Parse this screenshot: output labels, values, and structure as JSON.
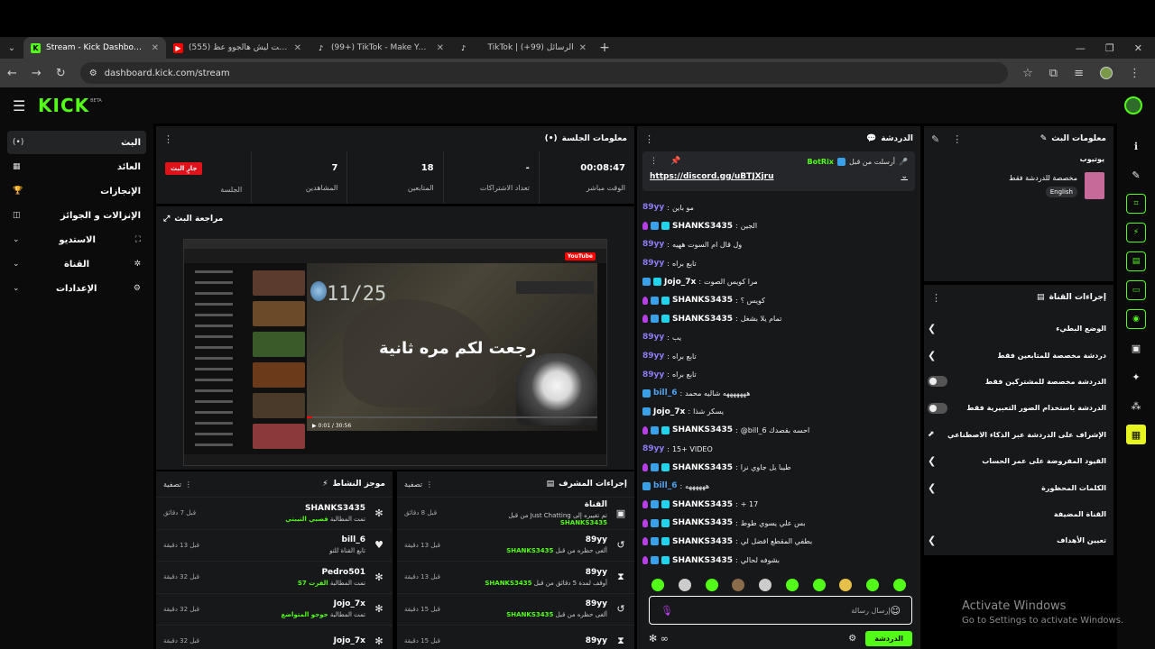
{
  "browser": {
    "tabs": [
      {
        "label": "Stream - Kick Dashboard",
        "active": true,
        "icon": "kick-icon"
      },
      {
        "label": "(555) عرفت ليش هالجوو عظ...",
        "active": false,
        "icon": "youtube-icon"
      },
      {
        "label": "(99+) TikTok - Make Your Day",
        "active": false,
        "icon": "tiktok-icon"
      },
      {
        "label": "TikTok | الرسائل (99+)",
        "active": false,
        "icon": "tiktok-icon"
      }
    ],
    "url": "dashboard.kick.com/stream"
  },
  "header": {
    "logo": "KICK",
    "beta": "BETA"
  },
  "sidebar": {
    "items": [
      {
        "label": "البث",
        "icon": "(•)"
      },
      {
        "label": "العائد",
        "icon": "▦"
      },
      {
        "label": "الإنجازات",
        "icon": "🏆"
      },
      {
        "label": "الإنزالات و الجوائز",
        "icon": "◫"
      },
      {
        "label": "الاستديو",
        "icon": "⛶"
      },
      {
        "label": "القناة",
        "icon": "✲"
      },
      {
        "label": "الإعدادات",
        "icon": "⚙"
      }
    ]
  },
  "session": {
    "title": "معلومات الجلسة",
    "live_badge": "جارٍ البث",
    "stats": [
      {
        "value": "00:08:47",
        "label": "الوقت مباشر"
      },
      {
        "value": "-",
        "label": "تعداد الاشتراكات"
      },
      {
        "value": "18",
        "label": "المتابعين"
      },
      {
        "value": "7",
        "label": "المشاهدين"
      },
      {
        "value": "",
        "label": "الجلسة"
      }
    ]
  },
  "preview": {
    "title": "مراجعة البث",
    "counter": "11/25",
    "caption": "رجعت لكم مره ثانية",
    "time": "0:01 / 30:56",
    "progress": 0.02
  },
  "activity": {
    "title": "موجز النشاط",
    "filter": "تصفية",
    "rows": [
      {
        "user": "SHANKS3435",
        "text": "تمت المطالبة",
        "highlight": "قصبي التيبتي",
        "time": "قبل 7 دقائق",
        "icon": "✻"
      },
      {
        "user": "bill_6",
        "text": "تابع القناة للتو",
        "highlight": "",
        "time": "قبل 13 دقيقة",
        "icon": "♥"
      },
      {
        "user": "Pedro501",
        "text": "تمت المطالبة",
        "highlight": "الفرت S7",
        "time": "قبل 32 دقيقة",
        "icon": "✻"
      },
      {
        "user": "Jojo_7x",
        "text": "تمت المطالبة",
        "highlight": "جوجو المتواضع",
        "time": "قبل 32 دقيقة",
        "icon": "✻"
      },
      {
        "user": "Jojo_7x",
        "text": "",
        "highlight": "",
        "time": "قبل 32 دقيقة",
        "icon": "✻"
      }
    ]
  },
  "mod_actions": {
    "title": "إجراءات المشرف",
    "filter": "تصفية",
    "rows": [
      {
        "user": "القناة",
        "text": "تم تغييره إلى Just Chatting من قبل",
        "highlight": "SHANKS3435",
        "time": "قبل 8 دقائق",
        "icon": "▣"
      },
      {
        "user": "89yy",
        "text": "ألغى حظره من قبل",
        "highlight": "SHANKS3435",
        "time": "قبل 13 دقيقة",
        "icon": "↺"
      },
      {
        "user": "89yy",
        "text": "أوقف لمدة 5 دقائق من قبل",
        "highlight": "SHANKS3435",
        "time": "قبل 13 دقيقة",
        "icon": "⧗"
      },
      {
        "user": "89yy",
        "text": "ألغى حظره من قبل",
        "highlight": "SHANKS3435",
        "time": "قبل 15 دقيقة",
        "icon": "↺"
      },
      {
        "user": "89yy",
        "text": "",
        "highlight": "",
        "time": "قبل 15 دقيقة",
        "icon": "⧗"
      }
    ]
  },
  "chat": {
    "title": "الدردشة",
    "pinned": {
      "from_label": "أرسلت من قبل",
      "user": "BotRix",
      "link": "https://discord.gg/uBTJXjru"
    },
    "messages": [
      {
        "user": "89yy",
        "color": "#8b7cf6",
        "text": "مو باين",
        "badges": []
      },
      {
        "user": "SHANKS3435",
        "color": "#ffffff",
        "text": "الجين",
        "badges": [
          "mic",
          "mod",
          "cyan"
        ]
      },
      {
        "user": "89yy",
        "color": "#8b7cf6",
        "text": "ول قال ام السوت ههيه",
        "badges": []
      },
      {
        "user": "89yy",
        "color": "#8b7cf6",
        "text": "تابع براه",
        "badges": []
      },
      {
        "user": "Jojo_7x",
        "color": "#ffffff",
        "text": "مرا كويس الصوت",
        "badges": [
          "mod",
          "cyan"
        ]
      },
      {
        "user": "SHANKS3435",
        "color": "#ffffff",
        "text": "كويس ؟",
        "badges": [
          "mic",
          "mod",
          "cyan"
        ]
      },
      {
        "user": "SHANKS3435",
        "color": "#ffffff",
        "text": "تمام يلا بشغل",
        "badges": [
          "mic",
          "mod",
          "cyan"
        ]
      },
      {
        "user": "89yy",
        "color": "#8b7cf6",
        "text": "يب",
        "badges": []
      },
      {
        "user": "89yy",
        "color": "#8b7cf6",
        "text": "تابع براه",
        "badges": []
      },
      {
        "user": "89yy",
        "color": "#8b7cf6",
        "text": "تابع براه",
        "badges": []
      },
      {
        "user": "bill_6",
        "color": "#4ea3f0",
        "text": "هههههههه شاليه محمد",
        "badges": [
          "mod"
        ]
      },
      {
        "user": "Jojo_7x",
        "color": "#ffffff",
        "text": "يسكر شذا",
        "badges": [
          "mod"
        ]
      },
      {
        "user": "SHANKS3435",
        "color": "#ffffff",
        "text": "@bill_6 احسه بقصدك",
        "badges": [
          "mic",
          "mod",
          "cyan"
        ]
      },
      {
        "user": "89yy",
        "color": "#8b7cf6",
        "text": "15+ VIDEO",
        "badges": []
      },
      {
        "user": "SHANKS3435",
        "color": "#ffffff",
        "text": "طيبا يل جاوي نرا",
        "badges": [
          "mic",
          "mod",
          "cyan"
        ]
      },
      {
        "user": "bill_6",
        "color": "#4ea3f0",
        "text": "ههههههه",
        "badges": [
          "mod"
        ]
      },
      {
        "user": "SHANKS3435",
        "color": "#ffffff",
        "text": "+ 17",
        "badges": [
          "mic",
          "mod",
          "cyan"
        ]
      },
      {
        "user": "SHANKS3435",
        "color": "#ffffff",
        "text": "بس علي يسوي طوط",
        "badges": [
          "mic",
          "mod",
          "cyan"
        ]
      },
      {
        "user": "SHANKS3435",
        "color": "#ffffff",
        "text": "بطفي المقطع افضل لي",
        "badges": [
          "mic",
          "mod",
          "cyan"
        ]
      },
      {
        "user": "SHANKS3435",
        "color": "#ffffff",
        "text": "بشوفه لحالي",
        "badges": [
          "mic",
          "mod",
          "cyan"
        ]
      }
    ],
    "input_placeholder": "إرسال رسالة",
    "send_label": "الدردشة"
  },
  "stream_info": {
    "title": "معلومات البث",
    "stream_title": "يوتيوب",
    "category": "مخصصة للدردشة فقط",
    "language": "English"
  },
  "channel_actions": {
    "title": "إجراءات القناة",
    "rows": [
      {
        "label": "الوضع البطيء",
        "control": "chevron"
      },
      {
        "label": "دردشة مخصصة للمتابعين فقط",
        "control": "chevron"
      },
      {
        "label": "الدردشة مخصصة للمشتركين فقط",
        "control": "toggle"
      },
      {
        "label": "الدردشة باستخدام الصور التعبيرية فقط",
        "control": "toggle"
      },
      {
        "label": "الإشراف على الدردشة عبر الذكاء الاصطناعي",
        "control": "external"
      },
      {
        "label": "القيود المفروضة على عمر الحساب",
        "control": "chevron"
      },
      {
        "label": "الكلمات المحظورة",
        "control": "chevron"
      },
      {
        "label": "القناة المضيفة",
        "control": "none"
      },
      {
        "label": "تعيين الأهداف",
        "control": "chevron"
      }
    ]
  },
  "watermark": {
    "line1": "Activate Windows",
    "line2": "Go to Settings to activate Windows."
  }
}
